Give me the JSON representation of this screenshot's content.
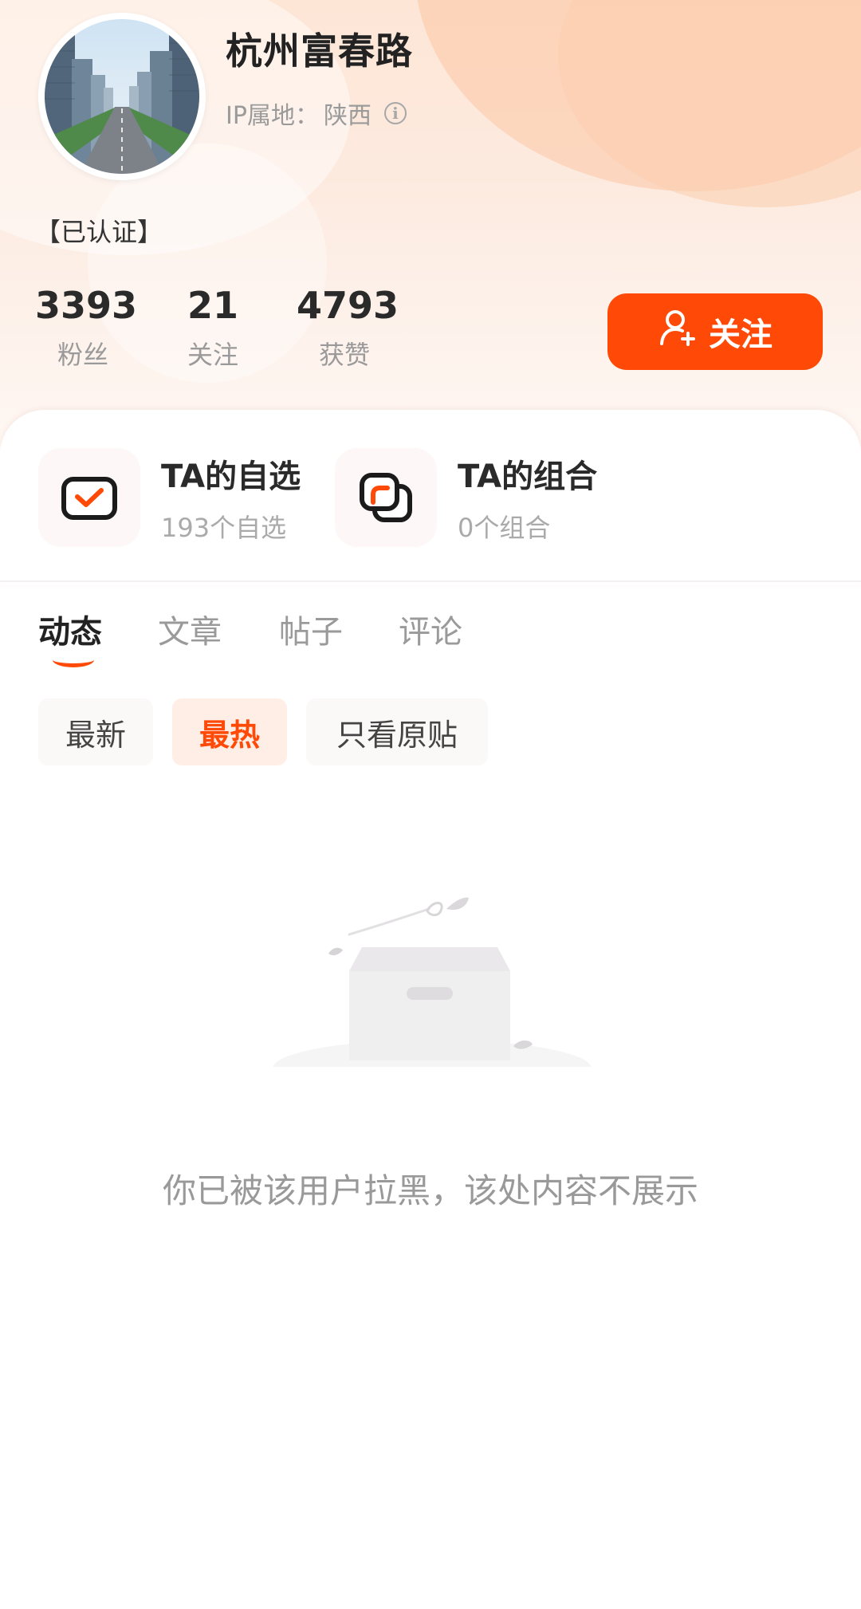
{
  "profile": {
    "username": "杭州富春路",
    "ip_label": "IP属地：",
    "ip_location": "陕西",
    "verified": "【已认证】"
  },
  "stats": [
    {
      "value": "3393",
      "label": "粉丝"
    },
    {
      "value": "21",
      "label": "关注"
    },
    {
      "value": "4793",
      "label": "获赞"
    }
  ],
  "follow_button": {
    "label": "关注",
    "color": "#fe4a06"
  },
  "entries": [
    {
      "title": "TA的自选",
      "subtitle": "193个自选",
      "icon": "watchlist-check-icon"
    },
    {
      "title": "TA的组合",
      "subtitle": "0个组合",
      "icon": "portfolio-combo-icon"
    }
  ],
  "tabs": [
    {
      "label": "动态",
      "active": true
    },
    {
      "label": "文章",
      "active": false
    },
    {
      "label": "帖子",
      "active": false
    },
    {
      "label": "评论",
      "active": false
    }
  ],
  "filters": [
    {
      "label": "最新",
      "active": false
    },
    {
      "label": "最热",
      "active": true
    },
    {
      "label": "只看原贴",
      "active": false
    }
  ],
  "empty_state": {
    "message": "你已被该用户拉黑，该处内容不展示",
    "icon": "empty-box-icon"
  },
  "colors": {
    "accent": "#fe4a06",
    "muted_text": "#9a9a9a"
  }
}
